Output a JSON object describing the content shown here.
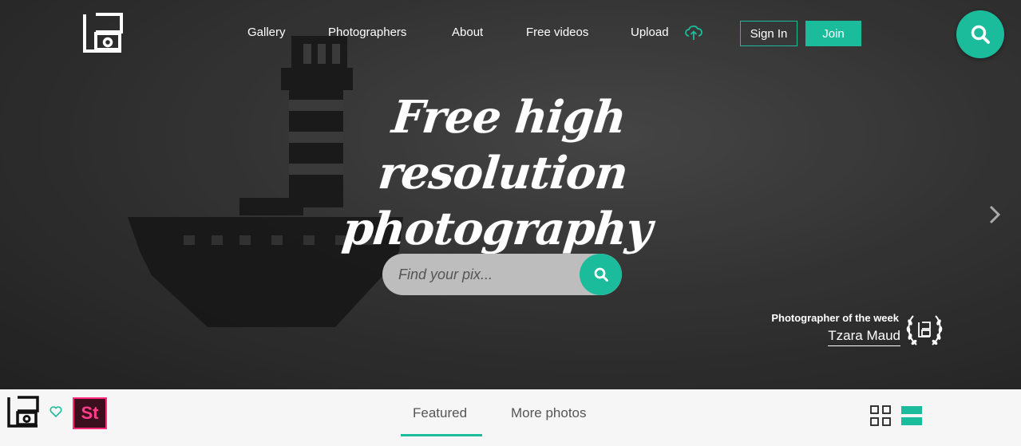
{
  "brand": {
    "accent": "#1abc9c",
    "stock_accent": "#ff2a7a"
  },
  "nav": {
    "items": [
      {
        "label": "Gallery"
      },
      {
        "label": "Photographers"
      },
      {
        "label": "About"
      },
      {
        "label": "Free videos"
      },
      {
        "label": "Upload"
      }
    ],
    "upload_icon": "cloud-upload-icon",
    "sign_in": "Sign In",
    "join": "Join",
    "search_icon": "search-icon"
  },
  "hero": {
    "headline_line1": "Free high resolution",
    "headline_line2": "photography",
    "search_placeholder": "Find your pix...",
    "next_icon": "chevron-right-icon",
    "photographer_of_week_label": "Photographer of the week",
    "photographer_name": "Tzara Maud"
  },
  "subbar": {
    "heart_icon": "heart-icon",
    "stock_badge": "St",
    "tabs": [
      {
        "label": "Featured",
        "active": true
      },
      {
        "label": "More photos",
        "active": false
      }
    ],
    "grid_view_icon": "grid-view-icon",
    "list_view_icon": "list-view-icon"
  }
}
